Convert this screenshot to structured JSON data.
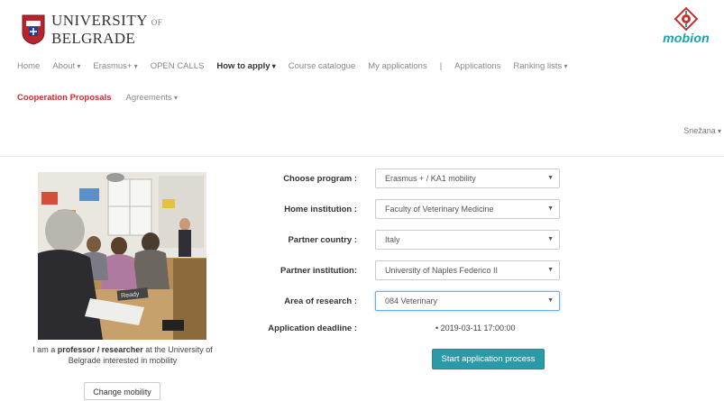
{
  "brand": {
    "university_line1": "UNIVERSITY",
    "university_of": "OF",
    "university_line2": "BELGRADE",
    "app_name": "mobion",
    "accent_color": "#2a9aa6",
    "active_color": "#c9302c"
  },
  "nav": {
    "items": [
      {
        "label": "Home",
        "dropdown": false
      },
      {
        "label": "About",
        "dropdown": true
      },
      {
        "label": "Erasmus+",
        "dropdown": true
      },
      {
        "label": "OPEN CALLS",
        "dropdown": false
      },
      {
        "label": "How to apply",
        "dropdown": true
      },
      {
        "label": "Course catalogue",
        "dropdown": false
      },
      {
        "label": "My applications",
        "dropdown": false
      },
      {
        "label": "|",
        "dropdown": false
      },
      {
        "label": "Applications",
        "dropdown": false
      },
      {
        "label": "Ranking lists",
        "dropdown": true
      }
    ],
    "secondary": {
      "active": "Cooperation Proposals",
      "agreements": "Agreements"
    }
  },
  "user": {
    "name": "Snežana"
  },
  "profile": {
    "caption_pre": "I am a ",
    "caption_bold1": "professor / researcher",
    "caption_mid": " at the University of Belgrade interested in mobility",
    "change_button": "Change mobility",
    "sign_text": "Ready"
  },
  "form": {
    "program_label": "Choose program :",
    "program_value": "Erasmus + / KA1 mobility",
    "home_label": "Home institution :",
    "home_value": "Faculty of Veterinary Medicine",
    "country_label": "Partner country :",
    "country_value": "Italy",
    "partner_label": "Partner institution:",
    "partner_value": "University of Naples Federico II",
    "area_label": "Area of research :",
    "area_value": "084 Veterinary",
    "deadline_label": "Application deadline :",
    "deadline_value": "• 2019-03-11 17:00:00",
    "start_button": "Start application process"
  }
}
